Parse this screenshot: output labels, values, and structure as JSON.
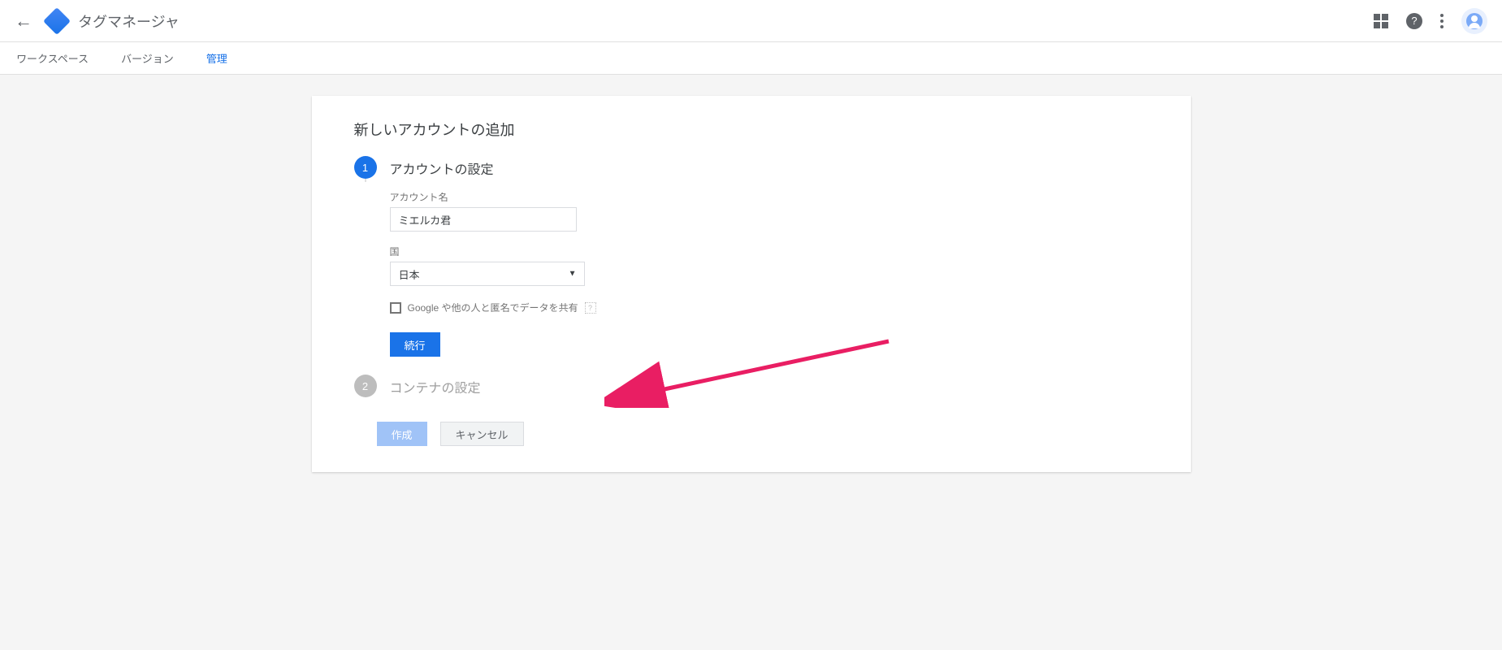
{
  "header": {
    "app_title": "タグマネージャ"
  },
  "tabs": {
    "workspace": "ワークスペース",
    "version": "バージョン",
    "admin": "管理"
  },
  "card": {
    "title": "新しいアカウントの追加",
    "step1": {
      "num": "1",
      "heading": "アカウントの設定",
      "account_name_label": "アカウント名",
      "account_name_value": "ミエルカ君",
      "country_label": "国",
      "country_value": "日本",
      "share_checkbox_label": "Google や他の人と匿名でデータを共有",
      "continue_button": "続行"
    },
    "step2": {
      "num": "2",
      "heading": "コンテナの設定"
    },
    "actions": {
      "create": "作成",
      "cancel": "キャンセル"
    }
  }
}
